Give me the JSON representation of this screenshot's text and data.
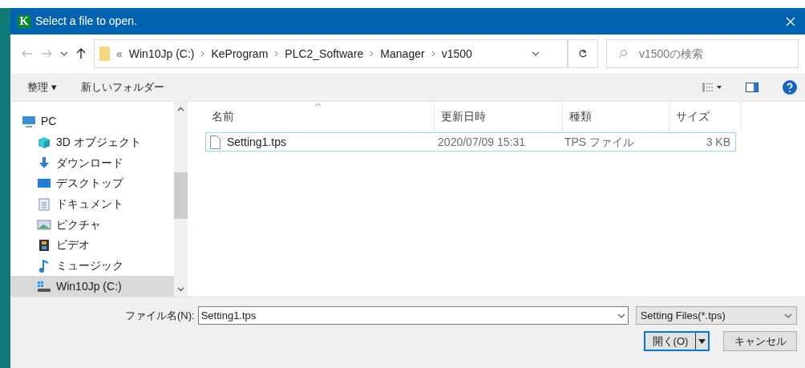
{
  "window": {
    "logo": "K",
    "title": "Select a file to open."
  },
  "address": {
    "overflow": "«",
    "segments": [
      "Win10Jp (C:)",
      "KeProgram",
      "PLC2_Software",
      "Manager",
      "v1500"
    ]
  },
  "search": {
    "placeholder": "v1500の検索"
  },
  "toolbar": {
    "organize": "整理 ▾",
    "new_folder": "新しいフォルダー"
  },
  "sidebar": {
    "items": [
      {
        "label": "PC",
        "kind": "pc",
        "selected": false
      },
      {
        "label": "3D オブジェクト",
        "kind": "cube",
        "selected": false
      },
      {
        "label": "ダウンロード",
        "kind": "download",
        "selected": false
      },
      {
        "label": "デスクトップ",
        "kind": "desktop",
        "selected": false
      },
      {
        "label": "ドキュメント",
        "kind": "document",
        "selected": false
      },
      {
        "label": "ピクチャ",
        "kind": "picture",
        "selected": false
      },
      {
        "label": "ビデオ",
        "kind": "video",
        "selected": false
      },
      {
        "label": "ミュージック",
        "kind": "music",
        "selected": false
      },
      {
        "label": "Win10Jp (C:)",
        "kind": "drive",
        "selected": true
      }
    ]
  },
  "table": {
    "columns": [
      "名前",
      "更新日時",
      "種類",
      "サイズ"
    ],
    "rows": [
      {
        "name": "Setting1.tps",
        "modified": "2020/07/09 15:31",
        "type": "TPS ファイル",
        "size": "3 KB",
        "selected": true
      }
    ]
  },
  "footer": {
    "filename_label": "ファイル名(N):",
    "filename": "Setting1.tps",
    "filter": "Setting Files(*.tps)",
    "open": "開く(O)",
    "cancel": "キャンセル"
  }
}
